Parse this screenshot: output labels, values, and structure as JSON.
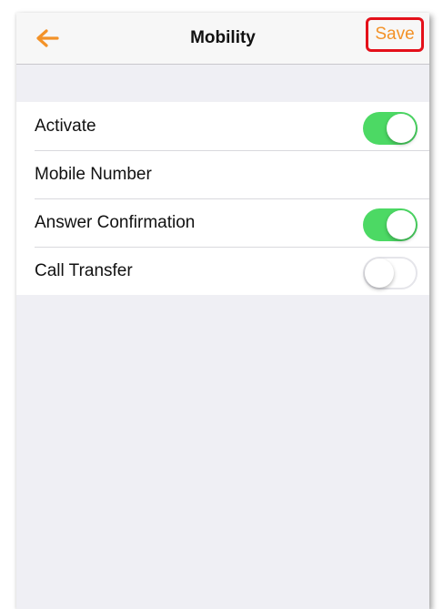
{
  "navbar": {
    "title": "Mobility",
    "save_label": "Save",
    "back_icon": "arrow-left-icon",
    "accent_color": "#f39228",
    "highlight_color": "#e4101a"
  },
  "settings": {
    "rows": [
      {
        "label": "Activate",
        "has_toggle": true,
        "toggle_on": true
      },
      {
        "label": "Mobile Number",
        "has_toggle": false
      },
      {
        "label": "Answer Confirmation",
        "has_toggle": true,
        "toggle_on": true
      },
      {
        "label": "Call Transfer",
        "has_toggle": true,
        "toggle_on": false
      }
    ],
    "toggle_on_color": "#4cd964"
  }
}
